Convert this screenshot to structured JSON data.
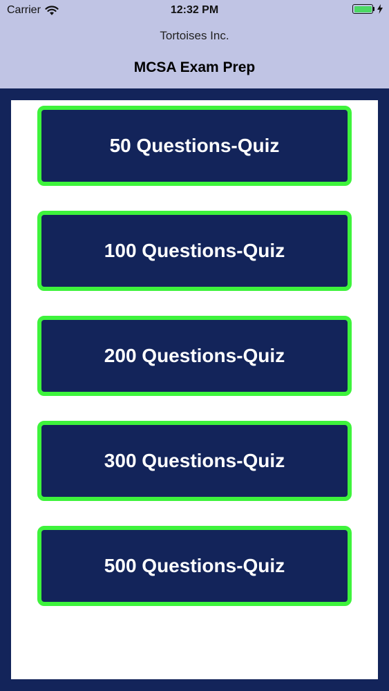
{
  "status_bar": {
    "carrier": "Carrier",
    "time": "12:32 PM",
    "battery_color": "#4cd964"
  },
  "header": {
    "subtitle": "Tortoises Inc.",
    "title": "MCSA Exam Prep",
    "background": "#c0c4e4"
  },
  "theme": {
    "navy": "#13245a",
    "accent_green": "#3ef33c"
  },
  "quizzes": [
    {
      "label": "50 Questions-Quiz"
    },
    {
      "label": "100 Questions-Quiz"
    },
    {
      "label": "200 Questions-Quiz"
    },
    {
      "label": "300 Questions-Quiz"
    },
    {
      "label": "500 Questions-Quiz"
    }
  ]
}
